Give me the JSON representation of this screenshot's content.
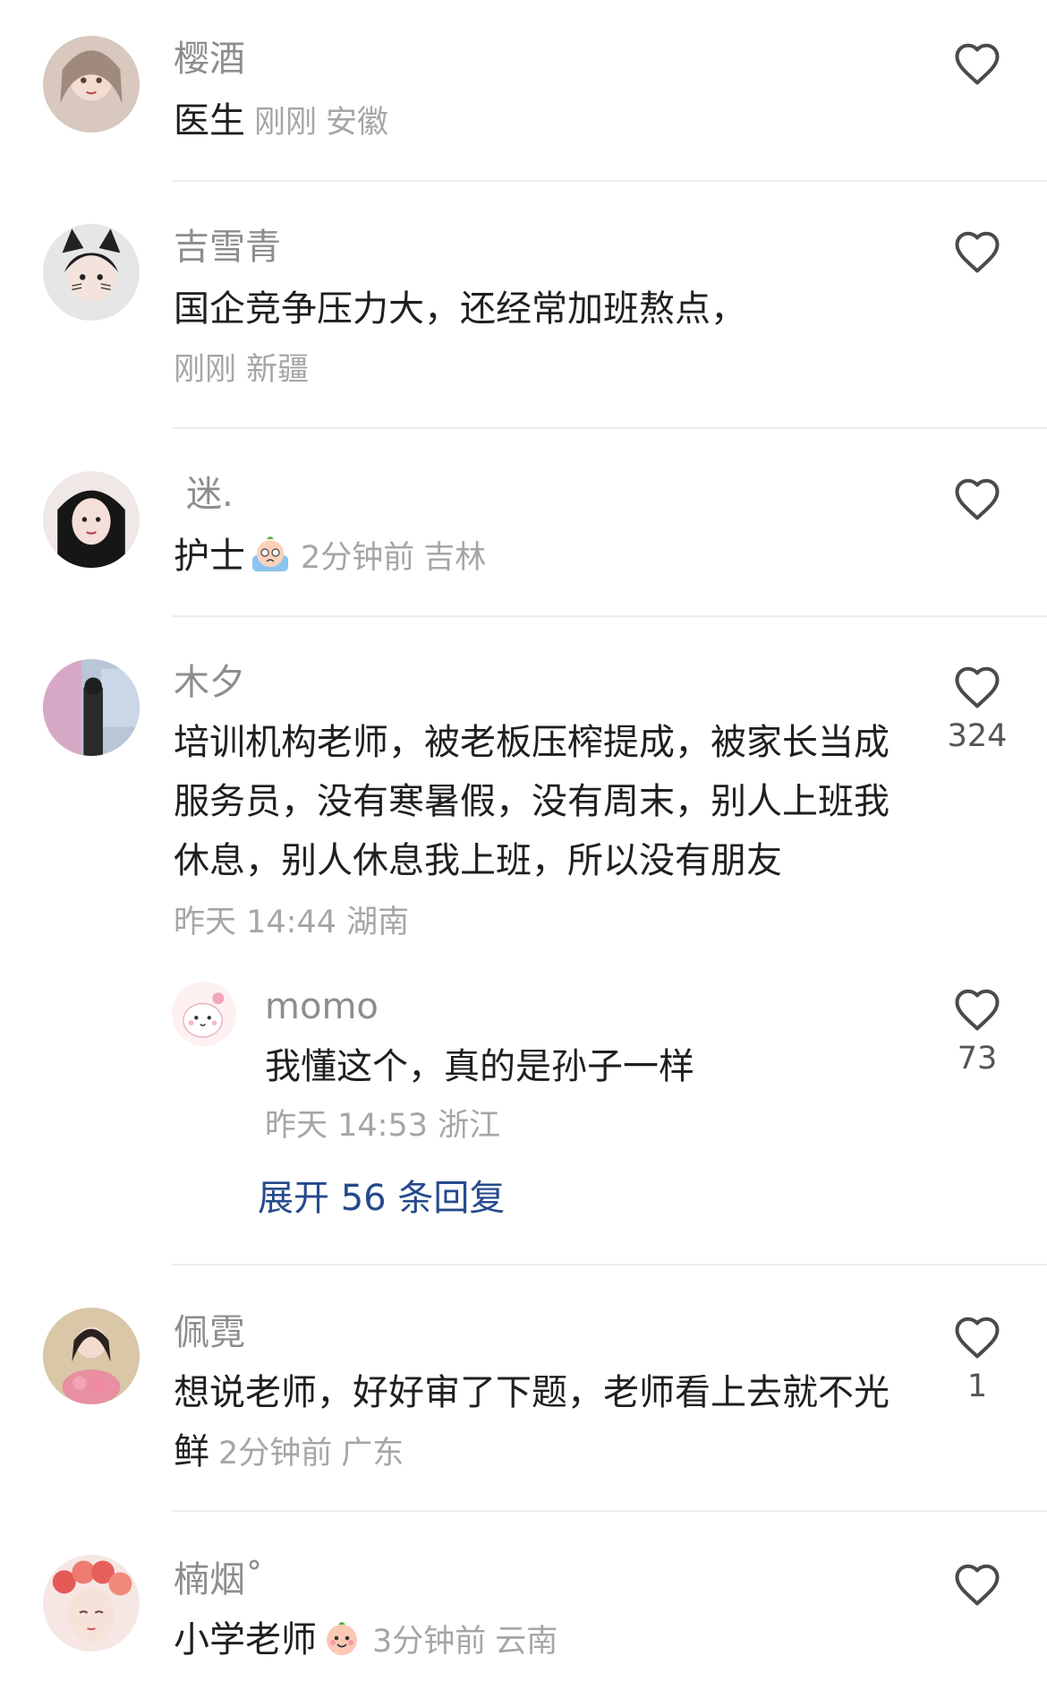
{
  "comments": [
    {
      "name": "樱酒",
      "text": "医生",
      "time": "刚刚",
      "location": "安徽",
      "likes": ""
    },
    {
      "name": "吉雪青",
      "text": "国企竞争压力大，还经常加班熬点，",
      "time": "刚刚",
      "location": "新疆",
      "likes": ""
    },
    {
      "name": "迷.",
      "text": "护士",
      "time": "2分钟前",
      "location": "吉林",
      "likes": ""
    },
    {
      "name": "木夕",
      "text": "培训机构老师，被老板压榨提成，被家长当成服务员，没有寒暑假，没有周末，别人上班我休息，别人休息我上班，所以没有朋友",
      "time": "昨天 14:44",
      "location": "湖南",
      "likes": "324"
    },
    {
      "name": "佩霓",
      "text": "想说老师，好好审了下题，老师看上去就不光鲜",
      "time": "2分钟前",
      "location": "广东",
      "likes": "1"
    },
    {
      "name": "楠烟˚",
      "text": "小学老师",
      "time": "3分钟前",
      "location": "云南",
      "likes": ""
    }
  ],
  "reply": {
    "name": "momo",
    "text": "我懂这个，真的是孙子一样",
    "time": "昨天 14:53",
    "location": "浙江",
    "likes": "73"
  },
  "expand_label": "展开 56 条回复",
  "icons": {
    "like": "heart-outline-icon",
    "emoji_crying": "crying-emoji-icon",
    "emoji_smile": "peach-smile-emoji-icon"
  },
  "colors": {
    "name": "#8d8d8d",
    "meta": "#a6a6a6",
    "link": "#254a8c",
    "divider": "#ededed"
  }
}
